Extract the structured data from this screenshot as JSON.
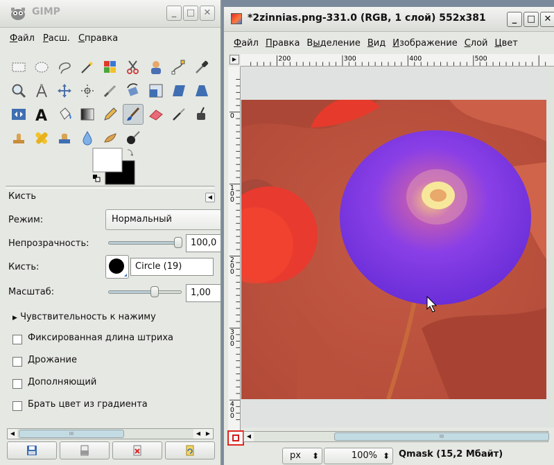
{
  "toolbox": {
    "title": "GIMP",
    "menu": [
      {
        "label": "Файл",
        "ul": "Ф",
        "rest": "айл"
      },
      {
        "label": "Расш.",
        "ul": "Р",
        "rest": "асш."
      },
      {
        "label": "Справка",
        "ul": "С",
        "rest": "правка"
      }
    ],
    "tool_options": {
      "title": "Кисть",
      "mode_label": "Режим:",
      "mode_value": "Нормальный",
      "opacity_label": "Непрозрачность:",
      "opacity_value": "100,0",
      "opacity_fraction": 1.0,
      "brush_label": "Кисть:",
      "brush_value": "Circle (19)",
      "scale_label": "Масштаб:",
      "scale_value": "1,00",
      "scale_fraction": 0.6,
      "pressure_expander": "Чувствительность к нажиму",
      "checkboxes": [
        {
          "label": "Фиксированная длина штриха",
          "checked": false
        },
        {
          "label": "Дрожание",
          "checked": false
        },
        {
          "label": "Дополняющий",
          "checked": false
        },
        {
          "label": "Брать цвет из градиента",
          "checked": false
        }
      ]
    },
    "scroll_thumb_text": "III"
  },
  "image_window": {
    "title": "*2zinnias.png-331.0 (RGB, 1 слой) 552x381",
    "menu": [
      {
        "label": "Файл",
        "ul": "Ф",
        "rest": "айл"
      },
      {
        "label": "Правка",
        "ul": "П",
        "rest": "равка"
      },
      {
        "label": "Выделение",
        "ul": "В",
        "rest": "ыделение",
        "ul_pos": 1
      },
      {
        "label": "Вид",
        "ul": "В",
        "rest": "ид"
      },
      {
        "label": "Изображение",
        "ul": "И",
        "rest": "зображение"
      },
      {
        "label": "Слой",
        "ul": "С",
        "rest": "лой"
      },
      {
        "label": "Цвет",
        "ul": "Ц",
        "rest": "вет"
      }
    ],
    "ruler_h_labels": [
      "200",
      "300",
      "400",
      "500"
    ],
    "ruler_v_labels": [
      "0",
      "100",
      "200",
      "300",
      "400"
    ],
    "status": {
      "unit": "px",
      "zoom": "100%",
      "text": "Qmask (15,2 Мбайт)"
    },
    "scroll_thumb_text": "III"
  },
  "colors": {
    "accent": "#e0251e",
    "selection": "#b8ccd6",
    "fg_color": "#000000",
    "bg_color": "#ffffff"
  }
}
